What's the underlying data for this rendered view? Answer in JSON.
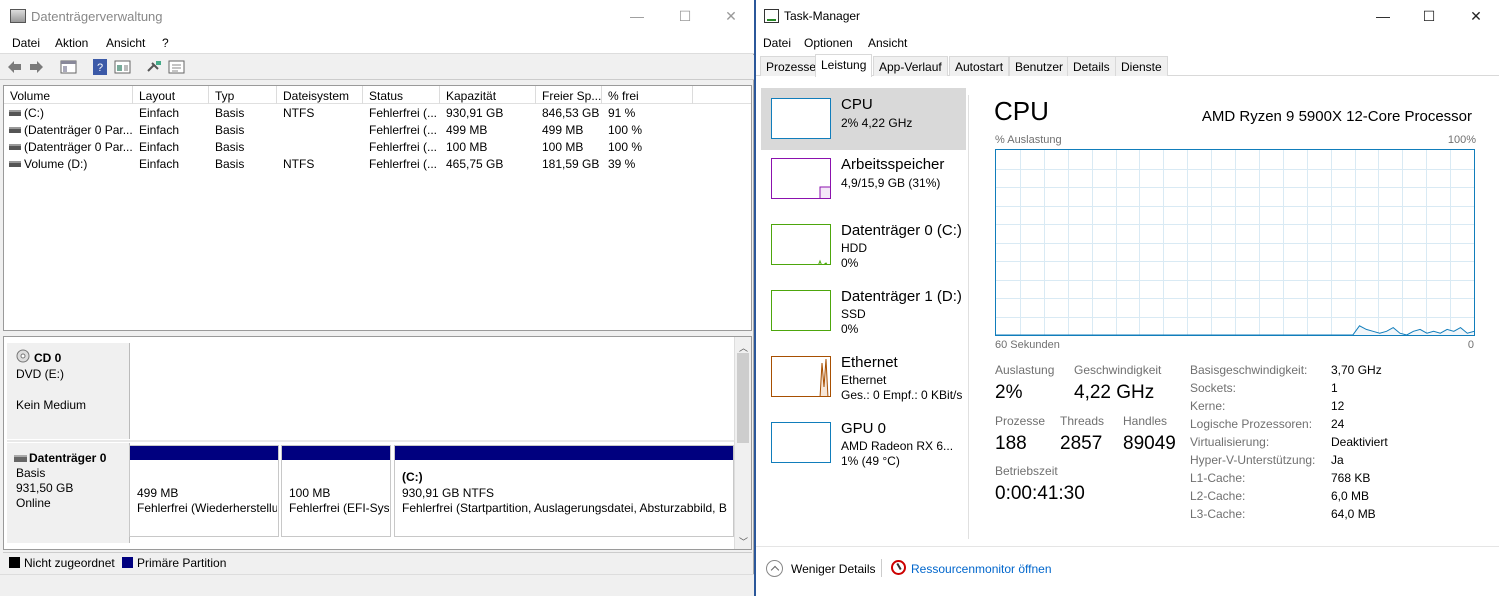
{
  "disk_mgmt": {
    "title": "Datenträgerverwaltung",
    "window_controls": {
      "minimize": "—",
      "maximize": "☐",
      "close": "✕"
    },
    "menu": [
      "Datei",
      "Aktion",
      "Ansicht",
      "?"
    ],
    "toolbar_icons": [
      "back-arrow-icon",
      "forward-arrow-icon",
      "console-tree-icon",
      "help-icon",
      "properties-icon",
      "connect-icon",
      "settings-icon"
    ],
    "columns": [
      "Volume",
      "Layout",
      "Typ",
      "Dateisystem",
      "Status",
      "Kapazität",
      "Freier Sp...",
      "% frei"
    ],
    "rows": [
      [
        "(C:)",
        "Einfach",
        "Basis",
        "NTFS",
        "Fehlerfrei (...",
        "930,91 GB",
        "846,53 GB",
        "91 %"
      ],
      [
        "(Datenträger 0 Par...",
        "Einfach",
        "Basis",
        "",
        "Fehlerfrei (...",
        "499 MB",
        "499 MB",
        "100 %"
      ],
      [
        "(Datenträger 0 Par...",
        "Einfach",
        "Basis",
        "",
        "Fehlerfrei (...",
        "100 MB",
        "100 MB",
        "100 %"
      ],
      [
        "Volume (D:)",
        "Einfach",
        "Basis",
        "NTFS",
        "Fehlerfrei (...",
        "465,75 GB",
        "181,59 GB",
        "39 %"
      ]
    ],
    "cd": {
      "name": "CD 0",
      "type": "DVD (E:)",
      "status": "Kein Medium"
    },
    "disk0": {
      "name": "Datenträger 0",
      "type": "Basis",
      "size": "931,50 GB",
      "status": "Online",
      "partitions": [
        {
          "title": "",
          "size": "499 MB",
          "status": "Fehlerfrei (Wiederherstellu"
        },
        {
          "title": "",
          "size": "100 MB",
          "status": "Fehlerfrei (EFI-Syst"
        },
        {
          "title": "(C:)",
          "size": "930,91 GB NTFS",
          "status": "Fehlerfrei (Startpartition, Auslagerungsdatei, Absturzabbild, Ba"
        }
      ]
    },
    "legend": {
      "unallocated": "Nicht zugeordnet",
      "primary": "Primäre Partition"
    },
    "colors": {
      "primary_partition": "#00007f",
      "unallocated": "#000000"
    }
  },
  "task_manager": {
    "title": "Task-Manager",
    "window_controls": {
      "minimize": "—",
      "maximize": "☐",
      "close": "✕"
    },
    "menu": [
      "Datei",
      "Optionen",
      "Ansicht"
    ],
    "tabs": [
      "Prozesse",
      "Leistung",
      "App-Verlauf",
      "Autostart",
      "Benutzer",
      "Details",
      "Dienste"
    ],
    "active_tab": "Leistung",
    "sidebar": [
      {
        "title": "CPU",
        "sub1": "2% 4,22 GHz",
        "sub2": "",
        "color": "#117dbb"
      },
      {
        "title": "Arbeitsspeicher",
        "sub1": "4,9/15,9 GB (31%)",
        "sub2": "",
        "color": "#8b12ae"
      },
      {
        "title": "Datenträger 0 (C:)",
        "sub1": "HDD",
        "sub2": "0%",
        "color": "#4da60c"
      },
      {
        "title": "Datenträger 1 (D:)",
        "sub1": "SSD",
        "sub2": "0%",
        "color": "#4da60c"
      },
      {
        "title": "Ethernet",
        "sub1": "Ethernet",
        "sub2": "Ges.: 0 Empf.: 0 KBit/s",
        "color": "#a74f01"
      },
      {
        "title": "GPU 0",
        "sub1": "AMD Radeon RX 6...",
        "sub2": "1% (49 °C)",
        "color": "#117dbb"
      }
    ],
    "cpu": {
      "heading": "CPU",
      "processor": "AMD Ryzen 9 5900X 12-Core Processor",
      "y_label": "% Auslastung",
      "y_max": "100%",
      "x_label": "60 Sekunden",
      "x_min": "0",
      "stats": {
        "auslastung_label": "Auslastung",
        "auslastung": "2%",
        "geschw_label": "Geschwindigkeit",
        "geschw": "4,22 GHz",
        "prozesse_label": "Prozesse",
        "prozesse": "188",
        "threads_label": "Threads",
        "threads": "2857",
        "handles_label": "Handles",
        "handles": "89049",
        "betrieb_label": "Betriebszeit",
        "betrieb": "0:00:41:30"
      },
      "details": [
        [
          "Basisgeschwindigkeit:",
          "3,70 GHz"
        ],
        [
          "Sockets:",
          "1"
        ],
        [
          "Kerne:",
          "12"
        ],
        [
          "Logische Prozessoren:",
          "24"
        ],
        [
          "Virtualisierung:",
          "Deaktiviert"
        ],
        [
          "Hyper-V-Unterstützung:",
          "Ja"
        ],
        [
          "L1-Cache:",
          "768 KB"
        ],
        [
          "L2-Cache:",
          "6,0 MB"
        ],
        [
          "L3-Cache:",
          "64,0 MB"
        ]
      ],
      "usage_history": [
        0,
        0,
        0,
        0,
        0,
        0,
        0,
        0,
        0,
        0,
        0,
        0,
        0,
        0,
        0,
        0,
        0,
        0,
        0,
        0,
        0,
        0,
        0,
        0,
        0,
        0,
        0,
        0,
        0,
        0,
        0,
        0,
        0,
        0,
        0,
        0,
        0,
        0,
        0,
        0,
        0,
        0,
        0,
        0,
        0,
        0,
        0,
        0,
        0,
        0,
        0,
        0,
        0,
        0,
        5,
        3,
        2,
        1,
        2,
        4,
        1,
        0,
        2,
        3,
        1,
        2,
        1,
        3,
        2,
        4,
        1,
        2
      ]
    },
    "footer": {
      "less_details": "Weniger Details",
      "resmon": "Ressourcenmonitor öffnen"
    },
    "colors": {
      "cpu": "#117dbb",
      "link": "#0066cc"
    }
  }
}
